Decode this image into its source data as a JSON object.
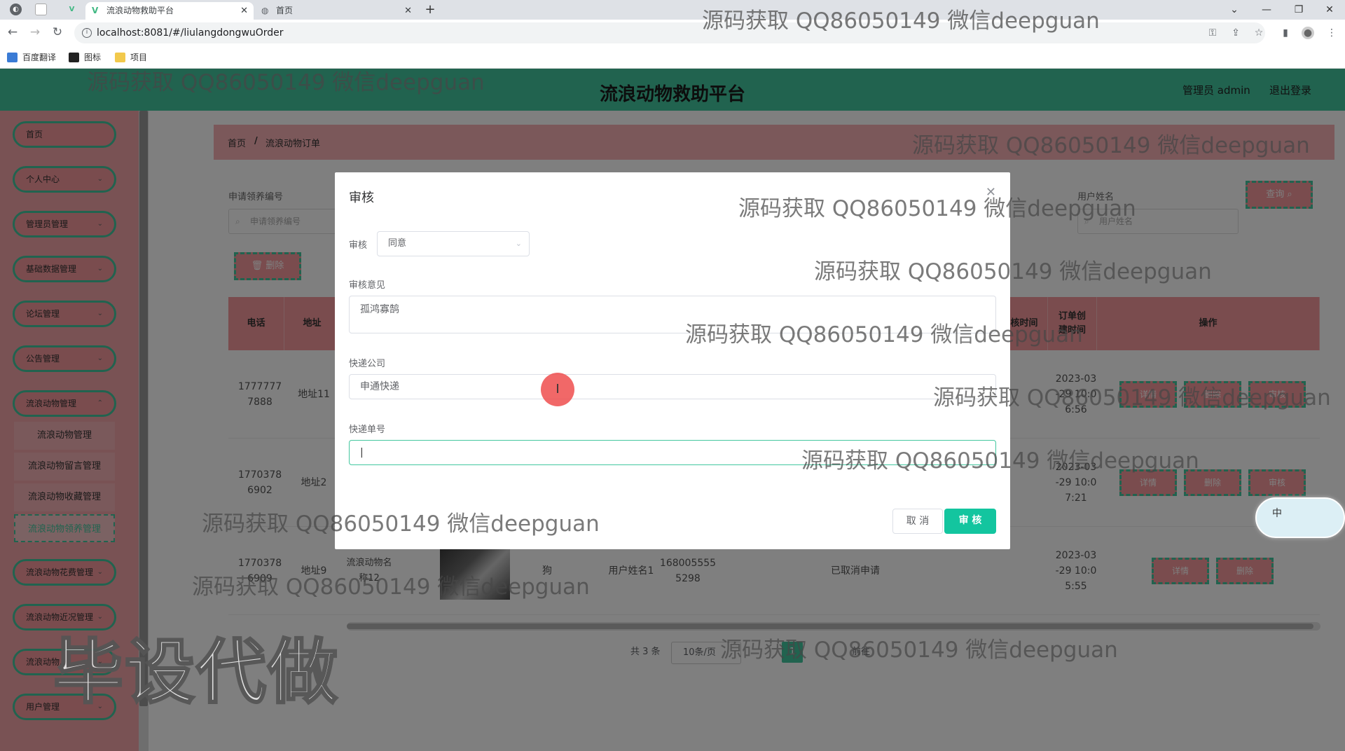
{
  "browser": {
    "tabs": [
      {
        "title": "流浪动物救助平台",
        "active": true
      },
      {
        "title": "首页",
        "active": false
      }
    ],
    "url": "localhost:8081/#/liulangdongwuOrder",
    "bookmarks": [
      "百度翻译",
      "图标",
      "项目"
    ]
  },
  "header": {
    "title": "流浪动物救助平台",
    "user": "管理员 admin",
    "logout": "退出登录"
  },
  "sidebar": {
    "items": [
      {
        "label": "首页"
      },
      {
        "label": "个人中心"
      },
      {
        "label": "管理员管理"
      },
      {
        "label": "基础数据管理"
      },
      {
        "label": "论坛管理"
      },
      {
        "label": "公告管理"
      },
      {
        "label": "流浪动物管理"
      }
    ],
    "subitems": [
      {
        "label": "流浪动物管理"
      },
      {
        "label": "流浪动物留言管理"
      },
      {
        "label": "流浪动物收藏管理"
      },
      {
        "label": "流浪动物领养管理"
      }
    ],
    "items_after": [
      {
        "label": "流浪动物花费管理"
      },
      {
        "label": "流浪动物近况管理"
      },
      {
        "label": "流浪动物..."
      },
      {
        "label": "用户管理"
      }
    ]
  },
  "breadcrumb": {
    "home": "首页",
    "sep": "/",
    "current": "流浪动物订单"
  },
  "filters": {
    "order_no_label": "申请领养编号",
    "order_no_placeholder": "申请领养编号",
    "username_label": "用户姓名",
    "username_placeholder": "用户姓名",
    "search_btn": "查询",
    "delete_btn": "删除"
  },
  "table": {
    "headers": [
      "电话",
      "地址",
      "审核时间",
      "订单创建时间",
      "操作"
    ],
    "rows": [
      {
        "phone": "17777777888",
        "addr": "地址11",
        "create_time": "2023-03-29 10:06:56",
        "actions": [
          "详情",
          "删除",
          "审核"
        ]
      },
      {
        "phone": "17703786902",
        "addr": "地址2",
        "create_time": "2023-03-29 10:07:21",
        "actions": [
          "详情",
          "删除",
          "审核"
        ]
      },
      {
        "phone": "17703786909",
        "addr": "地址9",
        "animal": "流浪动物名称12",
        "type": "狗",
        "uname": "用户姓名1",
        "uphone": "1680055555298",
        "status": "已取消申请",
        "create_time": "2023-03-29 10:05:55",
        "actions": [
          "详情",
          "删除"
        ]
      }
    ]
  },
  "pager": {
    "total": "共 3 条",
    "size": "10条/页",
    "page": "1",
    "goto": "前往"
  },
  "modal": {
    "title": "审核",
    "audit_label": "审核",
    "audit_value": "同意",
    "opinion_label": "审核意见",
    "opinion_value": "孤鸿寡鹄",
    "express_label": "快递公司",
    "express_value": "申通快递",
    "tracking_label": "快递单号",
    "tracking_value": "",
    "cancel": "取 消",
    "confirm": "审 核"
  },
  "watermark": {
    "text": "源码获取 QQ86050149 微信deepguan",
    "big": "毕设代做"
  },
  "ime": {
    "label": "中"
  },
  "colors": {
    "accent": "#43c79f",
    "pink": "#f4989c",
    "confirm": "#13c59f"
  }
}
